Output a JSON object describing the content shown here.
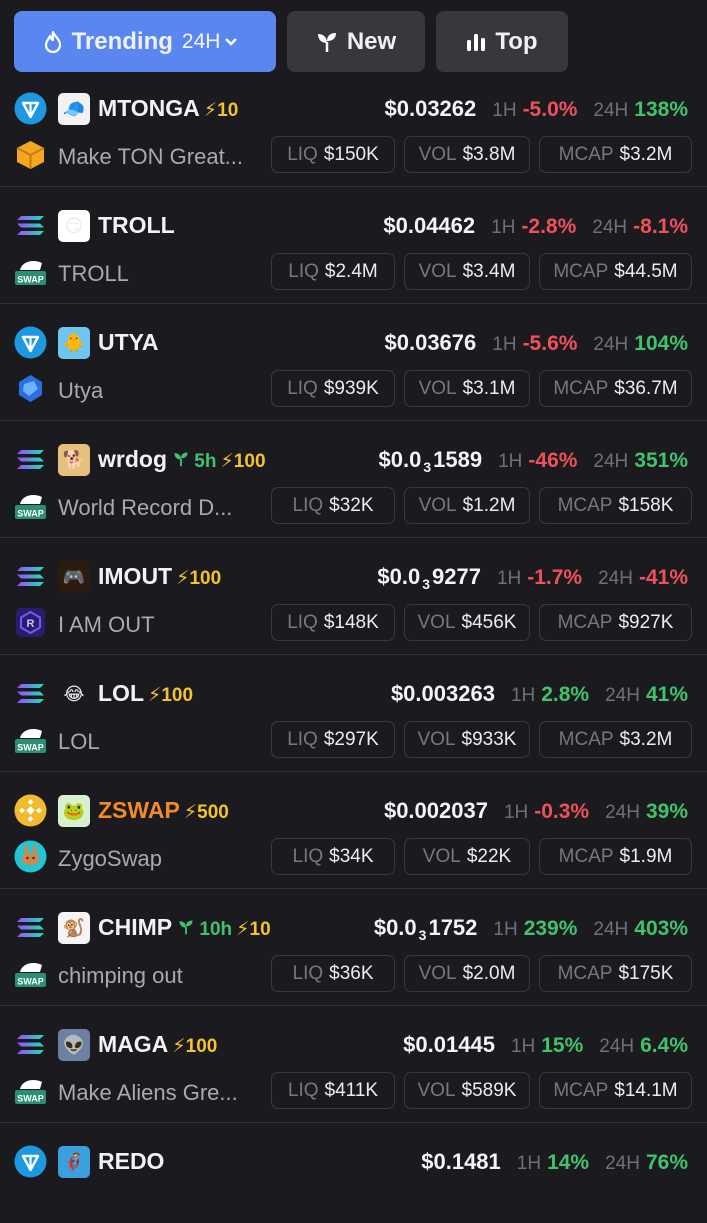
{
  "tabs": {
    "trending_label": "Trending",
    "trending_period": "24H",
    "new_label": "New",
    "top_label": "Top"
  },
  "labels": {
    "h1": "1H",
    "h24": "24H",
    "liq": "LIQ",
    "vol": "VOL",
    "mcap": "MCAP"
  },
  "colors": {
    "accent": "#5a86f0",
    "positive": "#3fc36b",
    "negative": "#f0505a",
    "boost": "#f2c230"
  },
  "tokens": [
    {
      "ticker": "MTONGA",
      "boost": "⚡10",
      "age": "",
      "name": "Make TON Great...",
      "price": "$0.03262",
      "price_sub": "",
      "price_tail": "",
      "h1": "-5.0%",
      "h24": "138%",
      "liq": "$150K",
      "vol": "$3.8M",
      "mcap": "$3.2M",
      "chain": "ton-icon",
      "dex": "box-icon"
    },
    {
      "ticker": "TROLL",
      "boost": "",
      "age": "",
      "name": "TROLL",
      "price": "$0.04462",
      "price_sub": "",
      "price_tail": "",
      "h1": "-2.8%",
      "h24": "-8.1%",
      "liq": "$2.4M",
      "vol": "$3.4M",
      "mcap": "$44.5M",
      "chain": "solana-icon",
      "dex": "swap-icon"
    },
    {
      "ticker": "UTYA",
      "boost": "",
      "age": "",
      "name": "Utya",
      "price": "$0.03676",
      "price_sub": "",
      "price_tail": "",
      "h1": "-5.6%",
      "h24": "104%",
      "liq": "$939K",
      "vol": "$3.1M",
      "mcap": "$36.7M",
      "chain": "ton-icon",
      "dex": "blue-swirl-icon"
    },
    {
      "ticker": "wrdog",
      "boost": "⚡100",
      "age": "5h",
      "name": "World Record D...",
      "price": "$0.0",
      "price_sub": "3",
      "price_tail": "1589",
      "h1": "-46%",
      "h24": "351%",
      "liq": "$32K",
      "vol": "$1.2M",
      "mcap": "$158K",
      "chain": "solana-icon",
      "dex": "swap-icon"
    },
    {
      "ticker": "IMOUT",
      "boost": "⚡100",
      "age": "",
      "name": "I AM OUT",
      "price": "$0.0",
      "price_sub": "3",
      "price_tail": "9277",
      "h1": "-1.7%",
      "h24": "-41%",
      "liq": "$148K",
      "vol": "$456K",
      "mcap": "$927K",
      "chain": "solana-icon",
      "dex": "raydium-icon"
    },
    {
      "ticker": "LOL",
      "boost": "⚡100",
      "age": "",
      "name": "LOL",
      "price": "$0.003263",
      "price_sub": "",
      "price_tail": "",
      "h1": "2.8%",
      "h24": "41%",
      "liq": "$297K",
      "vol": "$933K",
      "mcap": "$3.2M",
      "chain": "solana-icon",
      "dex": "swap-icon"
    },
    {
      "ticker": "ZSWAP",
      "boost": "⚡500",
      "age": "",
      "name": "ZygoSwap",
      "price": "$0.002037",
      "price_sub": "",
      "price_tail": "",
      "h1": "-0.3%",
      "h24": "39%",
      "liq": "$34K",
      "vol": "$22K",
      "mcap": "$1.9M",
      "chain": "bnb-icon",
      "dex": "pancakeswap-icon"
    },
    {
      "ticker": "CHIMP",
      "boost": "⚡10",
      "age": "10h",
      "name": "chimping out",
      "price": "$0.0",
      "price_sub": "3",
      "price_tail": "1752",
      "h1": "239%",
      "h24": "403%",
      "liq": "$36K",
      "vol": "$2.0M",
      "mcap": "$175K",
      "chain": "solana-icon",
      "dex": "swap-icon"
    },
    {
      "ticker": "MAGA",
      "boost": "⚡100",
      "age": "",
      "name": "Make Aliens Gre...",
      "price": "$0.01445",
      "price_sub": "",
      "price_tail": "",
      "h1": "15%",
      "h24": "6.4%",
      "liq": "$411K",
      "vol": "$589K",
      "mcap": "$14.1M",
      "chain": "solana-icon",
      "dex": "swap-icon"
    },
    {
      "ticker": "REDO",
      "boost": "",
      "age": "",
      "name": "",
      "price": "$0.1481",
      "price_sub": "",
      "price_tail": "",
      "h1": "14%",
      "h24": "76%",
      "liq": "",
      "vol": "",
      "mcap": "",
      "chain": "ton-icon",
      "dex": ""
    }
  ]
}
